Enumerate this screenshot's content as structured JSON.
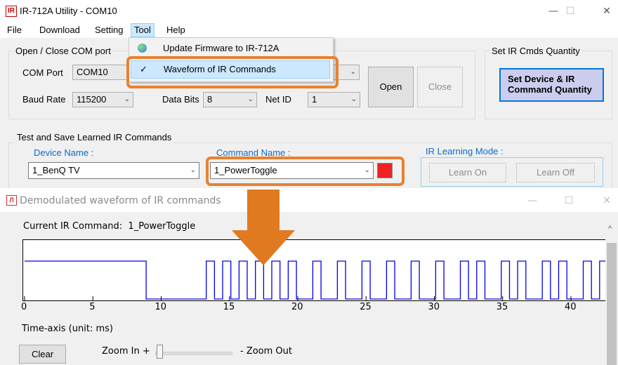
{
  "main_window": {
    "title": "IR-712A Utility - COM10",
    "icon_text": "IR",
    "controls": {
      "minimize": "—",
      "maximize": "☐",
      "close": "✕"
    },
    "menu": [
      "File",
      "Download",
      "Setting",
      "Tool",
      "Help"
    ],
    "tool_menu": {
      "items": [
        {
          "label": "Update Firmware to IR-712A",
          "icon": "globe-update-icon",
          "checked": false
        },
        {
          "label": "Waveform of IR Commands",
          "icon": "checkmark-icon",
          "checked": true,
          "check_glyph": "✓"
        }
      ]
    },
    "com_group": {
      "title": "Open / Close COM port",
      "com_port_label": "COM Port",
      "com_port_value": "COM10",
      "baud_label": "Baud Rate",
      "baud_value": "115200",
      "data_bits_label": "Data Bits",
      "data_bits_value": "8",
      "net_id_label": "Net ID",
      "net_id_value": "1",
      "open_button": "Open",
      "close_button": "Close"
    },
    "cmds_group": {
      "title": "Set IR Cmds Quantity",
      "button_line1": "Set Device & IR",
      "button_line2": "Command Quantity"
    },
    "test_group": {
      "title": "Test and Save Learned IR Commands",
      "device_label": "Device Name :",
      "device_value": "1_BenQ TV",
      "command_label": "Command Name :",
      "command_value": "1_PowerToggle",
      "learning_label": "IR Learning Mode :",
      "learn_on": "Learn On",
      "learn_off": "Learn Off"
    }
  },
  "wave_window": {
    "title": "Demodulated waveform of IR commands",
    "icon_text": "Л",
    "controls": {
      "minimize": "—",
      "maximize": "☐",
      "close": "✕"
    },
    "current_label": "Current IR Command:",
    "current_value": "1_PowerToggle",
    "axis_label": "Time-axis (unit: ms)",
    "clear_button": "Clear",
    "zoom_in_label": "Zoom In +",
    "zoom_out_label": "- Zoom Out",
    "scroll_up_glyph": "^"
  },
  "chart_data": {
    "type": "line",
    "title": "",
    "xlabel": "Time-axis (unit: ms)",
    "ylabel": "",
    "xlim": [
      0,
      42.6
    ],
    "ylim": [
      0,
      1
    ],
    "x_ticks": [
      0,
      5,
      10,
      15,
      20,
      25,
      30,
      35,
      40
    ],
    "series": [
      {
        "x": [
          0,
          8.9,
          8.9,
          13.3,
          13.3,
          13.9,
          13.9,
          14.5,
          14.5,
          15.1,
          15.1,
          15.7,
          15.7,
          16.3,
          16.3,
          16.9,
          16.9,
          17.5,
          17.5,
          18.1,
          18.1,
          18.7,
          18.7,
          19.3,
          19.3,
          19.9,
          19.9,
          21.1,
          21.1,
          21.7,
          21.7,
          22.9,
          22.9,
          23.5,
          23.5,
          24.7,
          24.7,
          25.3,
          25.3,
          26.5,
          26.5,
          27.1,
          27.1,
          28.3,
          28.3,
          28.9,
          28.9,
          30.1,
          30.1,
          30.7,
          30.7,
          31.9,
          31.9,
          32.5,
          32.5,
          33.1,
          33.1,
          33.7,
          33.7,
          34.9,
          34.9,
          35.5,
          35.5,
          36.1,
          36.1,
          36.7,
          36.7,
          37.9,
          37.9,
          38.5,
          38.5,
          39.1,
          39.1,
          39.7,
          39.7,
          40.9,
          40.9,
          41.5,
          41.5,
          42.1,
          42.1,
          42.6
        ],
        "y": [
          1,
          1,
          0,
          0,
          1,
          1,
          0,
          0,
          1,
          1,
          0,
          0,
          1,
          1,
          0,
          0,
          1,
          1,
          0,
          0,
          1,
          1,
          0,
          0,
          1,
          1,
          0,
          0,
          1,
          1,
          0,
          0,
          1,
          1,
          0,
          0,
          1,
          1,
          0,
          0,
          1,
          1,
          0,
          0,
          1,
          1,
          0,
          0,
          1,
          1,
          0,
          0,
          1,
          1,
          0,
          0,
          1,
          1,
          0,
          0,
          1,
          1,
          0,
          0,
          1,
          1,
          0,
          0,
          1,
          1,
          0,
          0,
          1,
          1,
          0,
          0,
          1,
          1,
          0,
          0,
          1,
          1
        ],
        "color": "#0000ee"
      }
    ],
    "grid": false
  },
  "colors": {
    "accent": "#0078d7",
    "highlight_frame": "#e8822e",
    "arrow": "#e07a20",
    "wave": "#0000ee",
    "label_blue": "#0b6bcd"
  }
}
